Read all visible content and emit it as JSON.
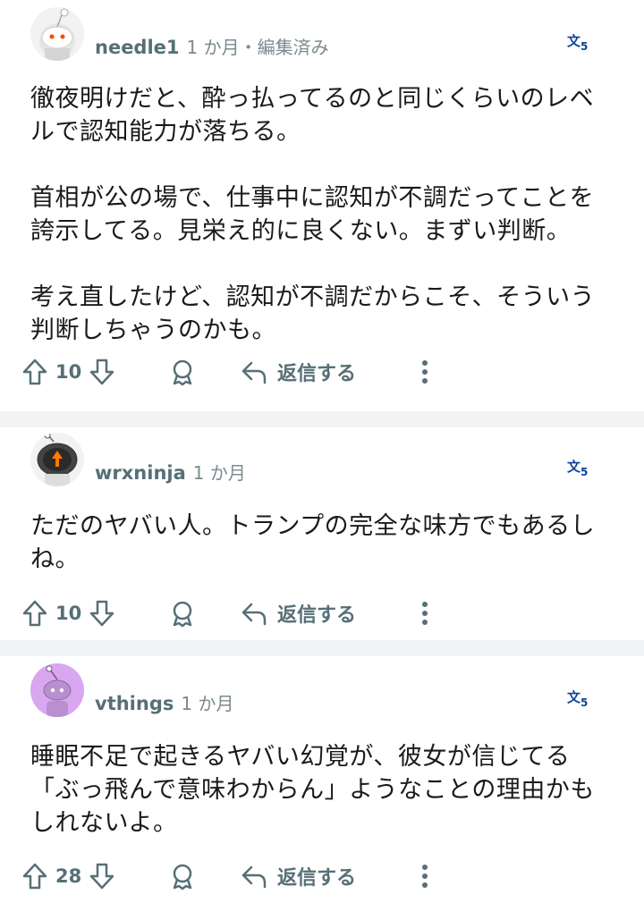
{
  "comments": [
    {
      "username": "needle1",
      "time": "1 か月・編集済み",
      "body": "徹夜明けだと、酔っ払ってるのと同じくらいのレベ\nルで認知能力が落ちる。\n\n首相が公の場で、仕事中に認知が不調だってことを\n誇示してる。見栄え的に良くない。まずい判断。\n\n考え直したけど、認知が不調だからこそ、そういう\n判断しちゃうのかも。",
      "votes": "10",
      "reply_label": "返信する"
    },
    {
      "username": "wrxninja",
      "time": "1 か月",
      "body": "ただのヤバい人。トランプの完全な味方でもあるし\nね。",
      "votes": "10",
      "reply_label": "返信する"
    },
    {
      "username": "vthings",
      "time": "1 か月",
      "body": "睡眠不足で起きるヤバい幻覚が、彼女が信じてる\n「ぶっ飛んで意味わからん」ようなことの理由かも\nしれないよ。",
      "votes": "28",
      "reply_label": "返信する"
    }
  ],
  "colors": {
    "meta": "#576f76",
    "separator": "#f1f3f4",
    "translate": "#0a449b"
  },
  "icons": [
    "upvote-icon",
    "downvote-icon",
    "award-icon",
    "reply-icon",
    "more-icon",
    "translate-icon"
  ]
}
